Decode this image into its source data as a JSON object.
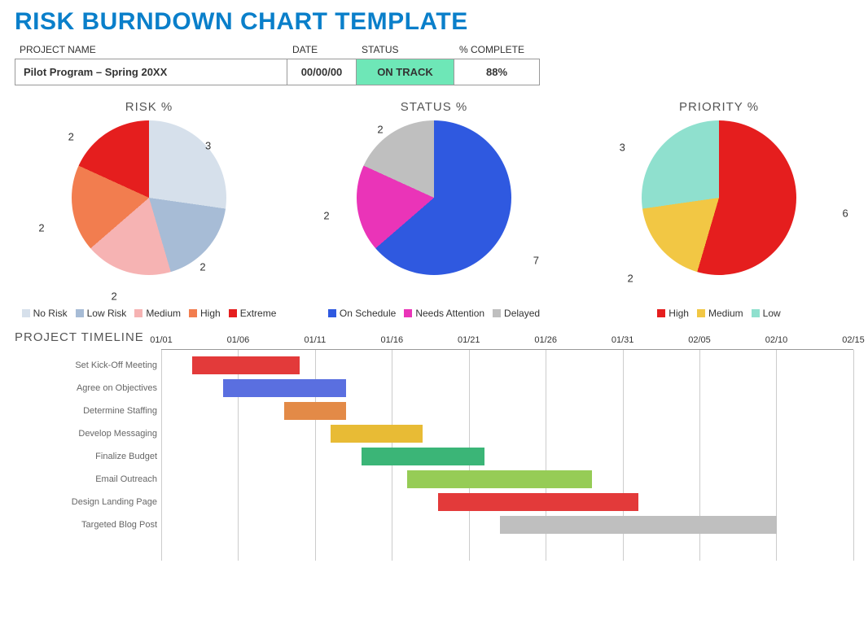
{
  "title": "RISK BURNDOWN CHART TEMPLATE",
  "meta": {
    "headers": {
      "name": "PROJECT NAME",
      "date": "DATE",
      "status": "STATUS",
      "complete": "% COMPLETE"
    },
    "name": "Pilot Program – Spring 20XX",
    "date": "00/00/00",
    "status": "ON TRACK",
    "complete": "88%"
  },
  "risk": {
    "title": "RISK %",
    "labels": {
      "a": "3",
      "b": "2",
      "c": "2",
      "d": "2",
      "e": "2"
    },
    "legend": {
      "a": "No Risk",
      "b": "Low Risk",
      "c": "Medium",
      "d": "High",
      "e": "Extreme"
    }
  },
  "status": {
    "title": "STATUS %",
    "labels": {
      "a": "7",
      "b": "2",
      "c": "2"
    },
    "legend": {
      "a": "On Schedule",
      "b": "Needs Attention",
      "c": "Delayed"
    }
  },
  "priority": {
    "title": "PRIORITY %",
    "labels": {
      "a": "6",
      "b": "2",
      "c": "3"
    },
    "legend": {
      "a": "High",
      "b": "Medium",
      "c": "Low"
    }
  },
  "timeline": {
    "title": "PROJECT TIMELINE",
    "ticks": {
      "0": "01/01",
      "1": "01/06",
      "2": "01/11",
      "3": "01/16",
      "4": "01/21",
      "5": "01/26",
      "6": "01/31",
      "7": "02/05",
      "8": "02/10",
      "9": "02/15"
    },
    "tasks": {
      "0": "Set Kick-Off Meeting",
      "1": "Agree on Objectives",
      "2": "Determine Staffing",
      "3": "Develop Messaging",
      "4": "Finalize Budget",
      "5": "Email Outreach",
      "6": "Design Landing Page",
      "7": "Targeted Blog Post"
    }
  },
  "chart_data": [
    {
      "type": "pie",
      "title": "RISK %",
      "series": [
        {
          "name": "No Risk",
          "value": 3,
          "color": "#d6e0eb"
        },
        {
          "name": "Low Risk",
          "value": 2,
          "color": "#a7bcd6"
        },
        {
          "name": "Medium",
          "value": 2,
          "color": "#f6b3b3"
        },
        {
          "name": "High",
          "value": 2,
          "color": "#f27d4f"
        },
        {
          "name": "Extreme",
          "value": 2,
          "color": "#e51e1e"
        }
      ]
    },
    {
      "type": "pie",
      "title": "STATUS %",
      "series": [
        {
          "name": "On Schedule",
          "value": 7,
          "color": "#2f59e0"
        },
        {
          "name": "Needs Attention",
          "value": 2,
          "color": "#ea34b8"
        },
        {
          "name": "Delayed",
          "value": 2,
          "color": "#bfbfbf"
        }
      ]
    },
    {
      "type": "pie",
      "title": "PRIORITY %",
      "series": [
        {
          "name": "High",
          "value": 6,
          "color": "#e51e1e"
        },
        {
          "name": "Medium",
          "value": 2,
          "color": "#f2c744"
        },
        {
          "name": "Low",
          "value": 3,
          "color": "#8fe0ce"
        }
      ]
    },
    {
      "type": "gantt",
      "title": "PROJECT TIMELINE",
      "x_ticks": [
        "01/01",
        "01/06",
        "01/11",
        "01/16",
        "01/21",
        "01/26",
        "01/31",
        "02/05",
        "02/10",
        "02/15"
      ],
      "xlabel": "",
      "tasks": [
        {
          "name": "Set Kick-Off Meeting",
          "start": "01/03",
          "end": "01/10",
          "color": "#e33a3a"
        },
        {
          "name": "Agree on Objectives",
          "start": "01/05",
          "end": "01/13",
          "color": "#5a6fe0"
        },
        {
          "name": "Determine Staffing",
          "start": "01/09",
          "end": "01/13",
          "color": "#e38a47"
        },
        {
          "name": "Develop Messaging",
          "start": "01/12",
          "end": "01/18",
          "color": "#e8bb35"
        },
        {
          "name": "Finalize Budget",
          "start": "01/14",
          "end": "01/22",
          "color": "#3bb577"
        },
        {
          "name": "Email Outreach",
          "start": "01/17",
          "end": "01/29",
          "color": "#96cc56"
        },
        {
          "name": "Design Landing Page",
          "start": "01/19",
          "end": "02/01",
          "color": "#e33a3a"
        },
        {
          "name": "Targeted Blog Post",
          "start": "01/23",
          "end": "02/10",
          "color": "#bfbfbf"
        }
      ]
    }
  ]
}
